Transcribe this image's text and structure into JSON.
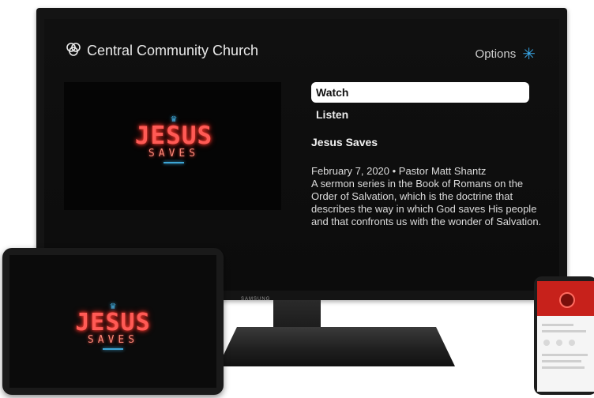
{
  "header": {
    "app_title": "Central Community Church",
    "options_label": "Options",
    "options_icon": "asterisk-icon"
  },
  "menu": {
    "items": [
      {
        "label": "Watch",
        "selected": true
      },
      {
        "label": "Listen",
        "selected": false
      }
    ]
  },
  "sermon": {
    "series_title": "Jesus Saves",
    "date_author": "February 7, 2020 • Pastor Matt Shantz",
    "description": "A sermon series in the Book of Romans on the Order of Salvation, which is the doctrine that describes the way in which God saves His people and that confronts us with the wonder of Salvation."
  },
  "artwork": {
    "line1": "JESUS",
    "line2": "SAVES",
    "crown_icon": "crown-icon"
  },
  "device": {
    "brand": "SAMSUNG"
  },
  "colors": {
    "accent": "#39a7e8",
    "neon_red": "#ff3b30",
    "neon_blue": "#3da6d6"
  }
}
